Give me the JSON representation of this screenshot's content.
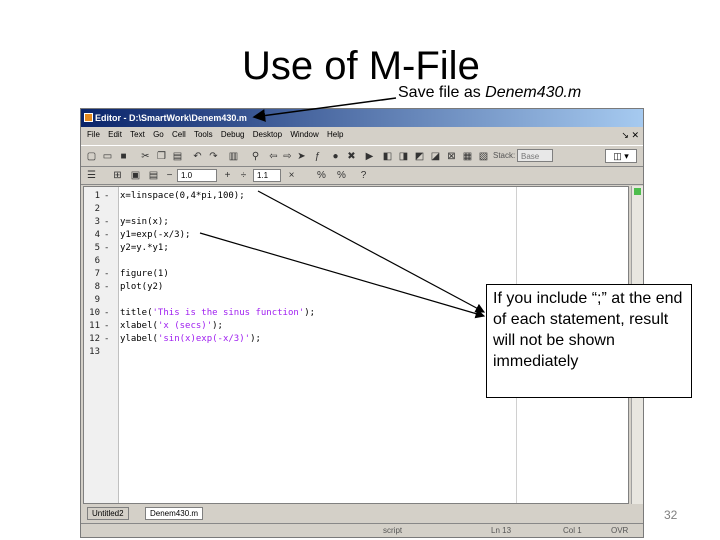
{
  "slide": {
    "title": "Use of M-File",
    "save_note_prefix": "Save file as ",
    "save_note_filename": "Denem430.m",
    "callout": "If you include “;” at the end of each statement, result will not be shown immediately",
    "page_number": "32"
  },
  "editor": {
    "title": "Editor - D:\\SmartWork\\Denem430.m",
    "menu": [
      "File",
      "Edit",
      "Text",
      "Go",
      "Cell",
      "Tools",
      "Debug",
      "Desktop",
      "Window",
      "Help"
    ],
    "stack_label": "Stack:",
    "stack_value": "Base",
    "cell_value_1": "1.0",
    "cell_value_2": "1.1",
    "code_lines": [
      {
        "n": "1",
        "mark": "-",
        "pre": "x=linspace(0,4*pi,100);",
        "str": "",
        "post": ""
      },
      {
        "n": "2",
        "mark": "",
        "pre": "",
        "str": "",
        "post": ""
      },
      {
        "n": "3",
        "mark": "-",
        "pre": "y=sin(x);",
        "str": "",
        "post": ""
      },
      {
        "n": "4",
        "mark": "-",
        "pre": "y1=exp(-x/3);",
        "str": "",
        "post": ""
      },
      {
        "n": "5",
        "mark": "-",
        "pre": "y2=y.*y1;",
        "str": "",
        "post": ""
      },
      {
        "n": "6",
        "mark": "",
        "pre": "",
        "str": "",
        "post": ""
      },
      {
        "n": "7",
        "mark": "-",
        "pre": "figure(1)",
        "str": "",
        "post": ""
      },
      {
        "n": "8",
        "mark": "-",
        "pre": "plot(y2)",
        "str": "",
        "post": ""
      },
      {
        "n": "9",
        "mark": "",
        "pre": "",
        "str": "",
        "post": ""
      },
      {
        "n": "10",
        "mark": "-",
        "pre": "title(",
        "str": "'This is the sinus function'",
        "post": ");"
      },
      {
        "n": "11",
        "mark": "-",
        "pre": "xlabel(",
        "str": "'x (secs)'",
        "post": ");"
      },
      {
        "n": "12",
        "mark": "-",
        "pre": "ylabel(",
        "str": "'sin(x)exp(-x/3)'",
        "post": ");"
      },
      {
        "n": "13",
        "mark": "",
        "pre": "",
        "str": "",
        "post": ""
      }
    ],
    "tabs": [
      {
        "label": "Untitled2",
        "active": false
      },
      {
        "label": "Denem430.m",
        "active": true
      }
    ],
    "status": {
      "mode": "script",
      "ln": "Ln 13",
      "col": "Col 1",
      "ovr": "OVR"
    }
  },
  "colors": {
    "titlebar_start": "#0a246a",
    "string_color": "#a020f0",
    "arrow": "#000000"
  }
}
